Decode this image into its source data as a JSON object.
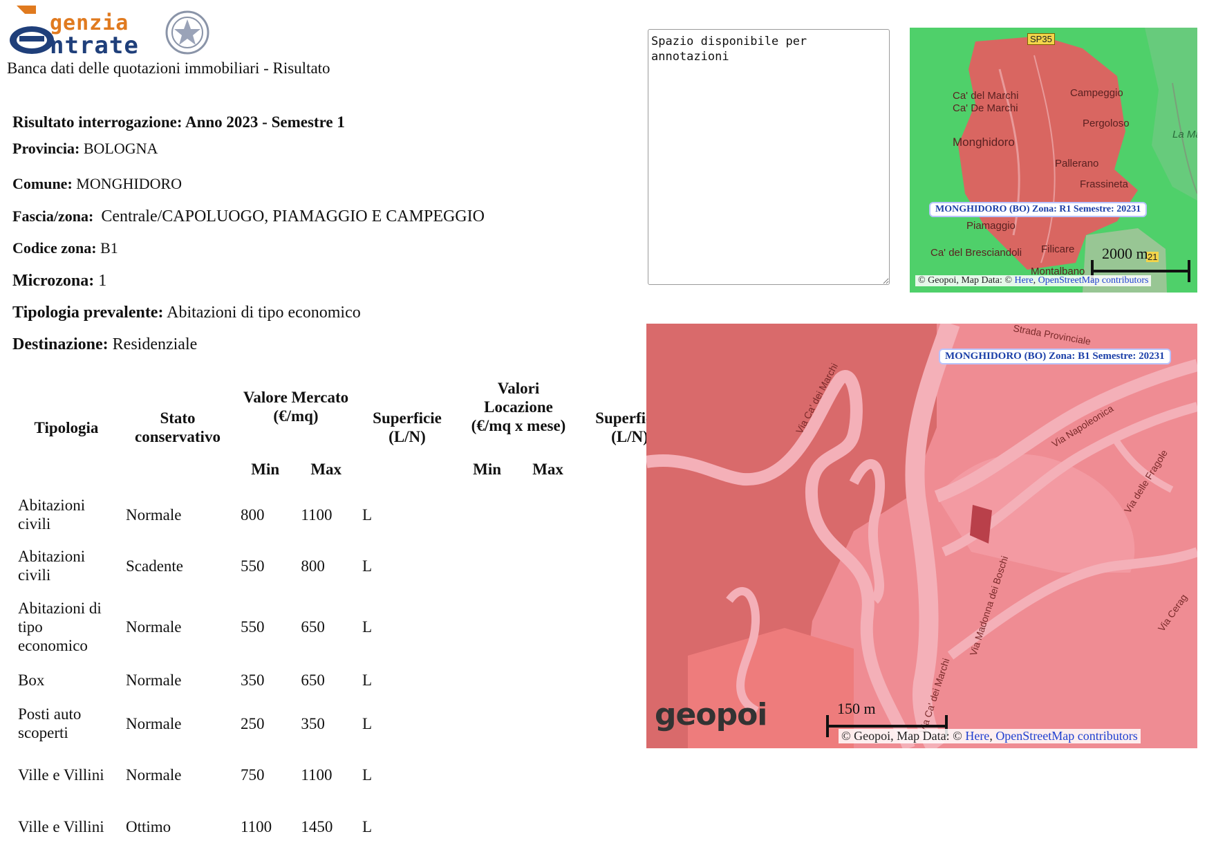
{
  "header": {
    "logo_top": "genzia",
    "logo_bottom": "ntrate",
    "subtitle": "Banca dati delle quotazioni immobiliari - Risultato"
  },
  "result": {
    "title": "Risultato interrogazione: Anno 2023 - Semestre 1",
    "provincia_label": "Provincia:",
    "provincia_value": "BOLOGNA",
    "comune_label": "Comune:",
    "comune_value": "MONGHIDORO",
    "fascia_label": "Fascia/zona:",
    "fascia_value": "Centrale/CAPOLUOGO, PIAMAGGIO E CAMPEGGIO",
    "codice_label": "Codice zona:",
    "codice_value": "B1",
    "microzona_label": "Microzona:",
    "microzona_value": "1",
    "tipologia_label": "Tipologia prevalente:",
    "tipologia_value": "Abitazioni di tipo economico",
    "destinazione_label": "Destinazione:",
    "destinazione_value": "Residenziale"
  },
  "table": {
    "headers": {
      "tipologia": "Tipologia",
      "stato": "Stato conservativo",
      "valore_mercato": "Valore Mercato (€/mq)",
      "superficie1": "Superficie (L/N)",
      "valori_locazione": "Valori Locazione (€/mq x mese)",
      "superficie2": "Superficie (L/N)",
      "min1": "Min",
      "max1": "Max",
      "min2": "Min",
      "max2": "Max"
    },
    "rows": [
      {
        "tipologia": "Abitazioni civili",
        "stato": "Normale",
        "min": "800",
        "max": "1100",
        "sup": "L"
      },
      {
        "tipologia": "Abitazioni civili",
        "stato": "Scadente",
        "min": "550",
        "max": "800",
        "sup": "L"
      },
      {
        "tipologia": "Abitazioni di tipo economico",
        "stato": "Normale",
        "min": "550",
        "max": "650",
        "sup": "L"
      },
      {
        "tipologia": "Box",
        "stato": "Normale",
        "min": "350",
        "max": "650",
        "sup": "L"
      },
      {
        "tipologia": "Posti auto scoperti",
        "stato": "Normale",
        "min": "250",
        "max": "350",
        "sup": "L"
      },
      {
        "tipologia": "Ville e Villini",
        "stato": "Normale",
        "min": "750",
        "max": "1100",
        "sup": "L"
      },
      {
        "tipologia": "Ville e Villini",
        "stato": "Ottimo",
        "min": "1100",
        "max": "1450",
        "sup": "L"
      }
    ]
  },
  "notes": {
    "value": "Spazio disponibile per annotazioni"
  },
  "map_small": {
    "zone_label": "MONGHIDORO (BO) Zona: R1 Semestre: 20231",
    "places": [
      "SP35",
      "Ca' del Marchi",
      "Ca' De Marchi",
      "Campeggio",
      "Pergoloso",
      "Monghidoro",
      "Pallerano",
      "Frassineta",
      "Piamaggio",
      "Ca' del Bresciandoli",
      "Filicare",
      "Montalbano",
      "La Ma",
      "21"
    ],
    "scale": "2000 m",
    "attribution_prefix": "© Geopoi, Map Data: © ",
    "attribution_link1": "Here",
    "attribution_link2": "OpenStreetMap contributors"
  },
  "map_large": {
    "zone_label": "MONGHIDORO (BO) Zona: B1 Semestre: 20231",
    "roads": [
      "Strada Provinciale",
      "Via Ca' dei Marchi",
      "Via Napoleonica",
      "Via delle Fragole",
      "Via Madonna dei Boschi",
      "Via Ca' dei Marchi",
      "Via Cerag"
    ],
    "scale": "150 m",
    "brand": "geopoi",
    "attribution_prefix": "© Geopoi, Map Data: © ",
    "attribution_link1": "Here",
    "attribution_link2": "OpenStreetMap contributors"
  }
}
